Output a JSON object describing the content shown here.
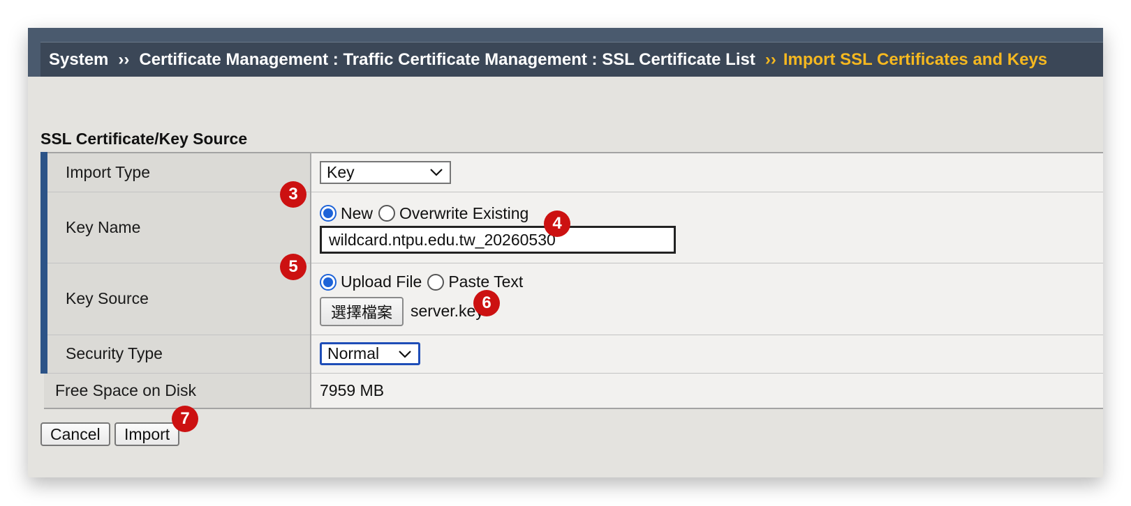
{
  "breadcrumb": {
    "items": [
      "System",
      "Certificate Management : Traffic Certificate Management : SSL Certificate List"
    ],
    "separator": "››",
    "current": "Import SSL Certificates and Keys"
  },
  "section_title": "SSL Certificate/Key Source",
  "form": {
    "import_type": {
      "label": "Import Type",
      "selected": "Key"
    },
    "key_name": {
      "label": "Key Name",
      "options": [
        "New",
        "Overwrite Existing"
      ],
      "selected": "New",
      "value": "wildcard.ntpu.edu.tw_20260530"
    },
    "key_source": {
      "label": "Key Source",
      "options": [
        "Upload File",
        "Paste Text"
      ],
      "selected": "Upload File",
      "file_button_label": "選擇檔案",
      "file_name": "server.key"
    },
    "security_type": {
      "label": "Security Type",
      "selected": "Normal"
    },
    "free_space": {
      "label": "Free Space on Disk",
      "value": "7959 MB"
    }
  },
  "buttons": {
    "cancel": "Cancel",
    "import": "Import"
  },
  "annotations": [
    "3",
    "4",
    "5",
    "6",
    "7"
  ],
  "colors": {
    "accent": "#f5b820",
    "required_bar": "#2c5387",
    "badge": "#cc1111",
    "radio": "#1d63d8"
  }
}
